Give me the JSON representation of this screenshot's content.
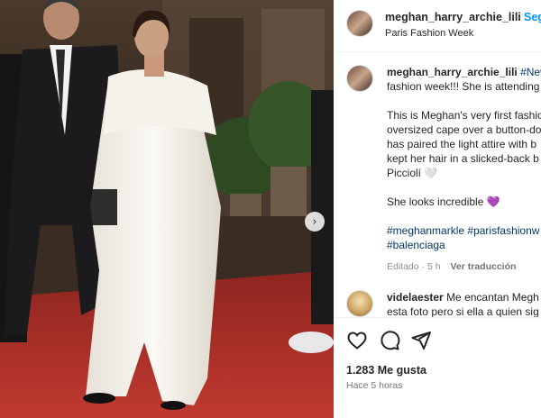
{
  "post": {
    "username": "meghan_harry_archie_lili",
    "follow_label": "Seg",
    "location": "Paris Fashion Week"
  },
  "caption": {
    "username": "meghan_harry_archie_lili",
    "hashtag_first": "#New",
    "line1": "fashion week!!! She is attending",
    "line2": "This is Meghan's very first fashio",
    "line3": "oversized cape over a button-do",
    "line4": "has paired the light attire with b",
    "line5": "kept her hair in a slicked-back b",
    "line6": "Picciolí",
    "line6_emoji": "🤍",
    "line7": "She looks incredible",
    "line7_emoji": "💜",
    "hashtags_line1a": "#meghanmarkle",
    "hashtags_line1b": "#parisfashionw",
    "hashtags_line2": "#balenciaga",
    "edited": "Editado · 5 h",
    "translate": "Ver traducción"
  },
  "comment": {
    "username": "videlaester",
    "text1": "Me encantan Megh",
    "text2": "esta foto pero si ella a quien sig"
  },
  "actions": {
    "likes": "1.283 Me gusta",
    "time": "Hace 5 horas"
  },
  "icons": {
    "like": "heart-icon",
    "comment": "comment-icon",
    "share": "paper-plane-icon",
    "next": "chevron-right-icon"
  },
  "colors": {
    "link": "#0095f6",
    "hashtag": "#00376b",
    "muted": "#8e8e8e",
    "carpet": "#b0322c"
  }
}
